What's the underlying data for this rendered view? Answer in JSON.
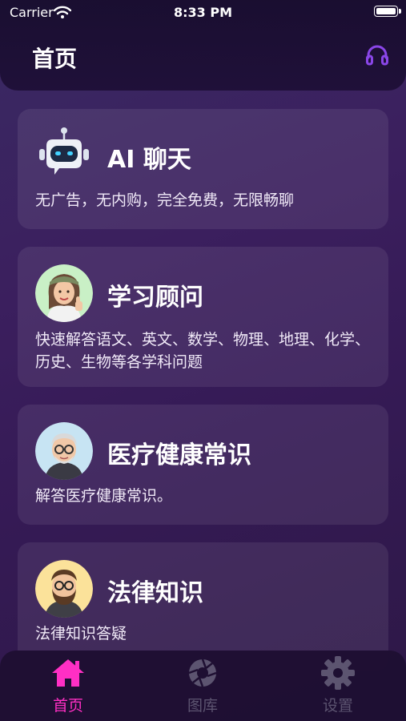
{
  "status_bar": {
    "carrier": "Carrier",
    "time": "8:33 PM"
  },
  "header": {
    "title": "首页"
  },
  "cards": [
    {
      "title": "AI 聊天",
      "description": "无广告，无内购，完全免费，无限畅聊",
      "icon": "robot-icon"
    },
    {
      "title": "学习顾问",
      "description": "快速解答语文、英文、数学、物理、地理、化学、历史、生物等各学科问题",
      "icon": "avatar-woman-thumbsup"
    },
    {
      "title": "医疗健康常识",
      "description": "解答医疗健康常识。",
      "icon": "avatar-grey-hair-glasses"
    },
    {
      "title": "法律知识",
      "description": "法律知识答疑",
      "icon": "avatar-bearded-man-glasses"
    }
  ],
  "tabs": [
    {
      "label": "首页",
      "icon": "home-icon",
      "active": true
    },
    {
      "label": "图库",
      "icon": "aperture-icon",
      "active": false
    },
    {
      "label": "设置",
      "icon": "gear-icon",
      "active": false
    }
  ],
  "colors": {
    "accent": "#ff2fc4",
    "support_icon": "#8a46e8",
    "inactive_tab": "#5c5470"
  }
}
